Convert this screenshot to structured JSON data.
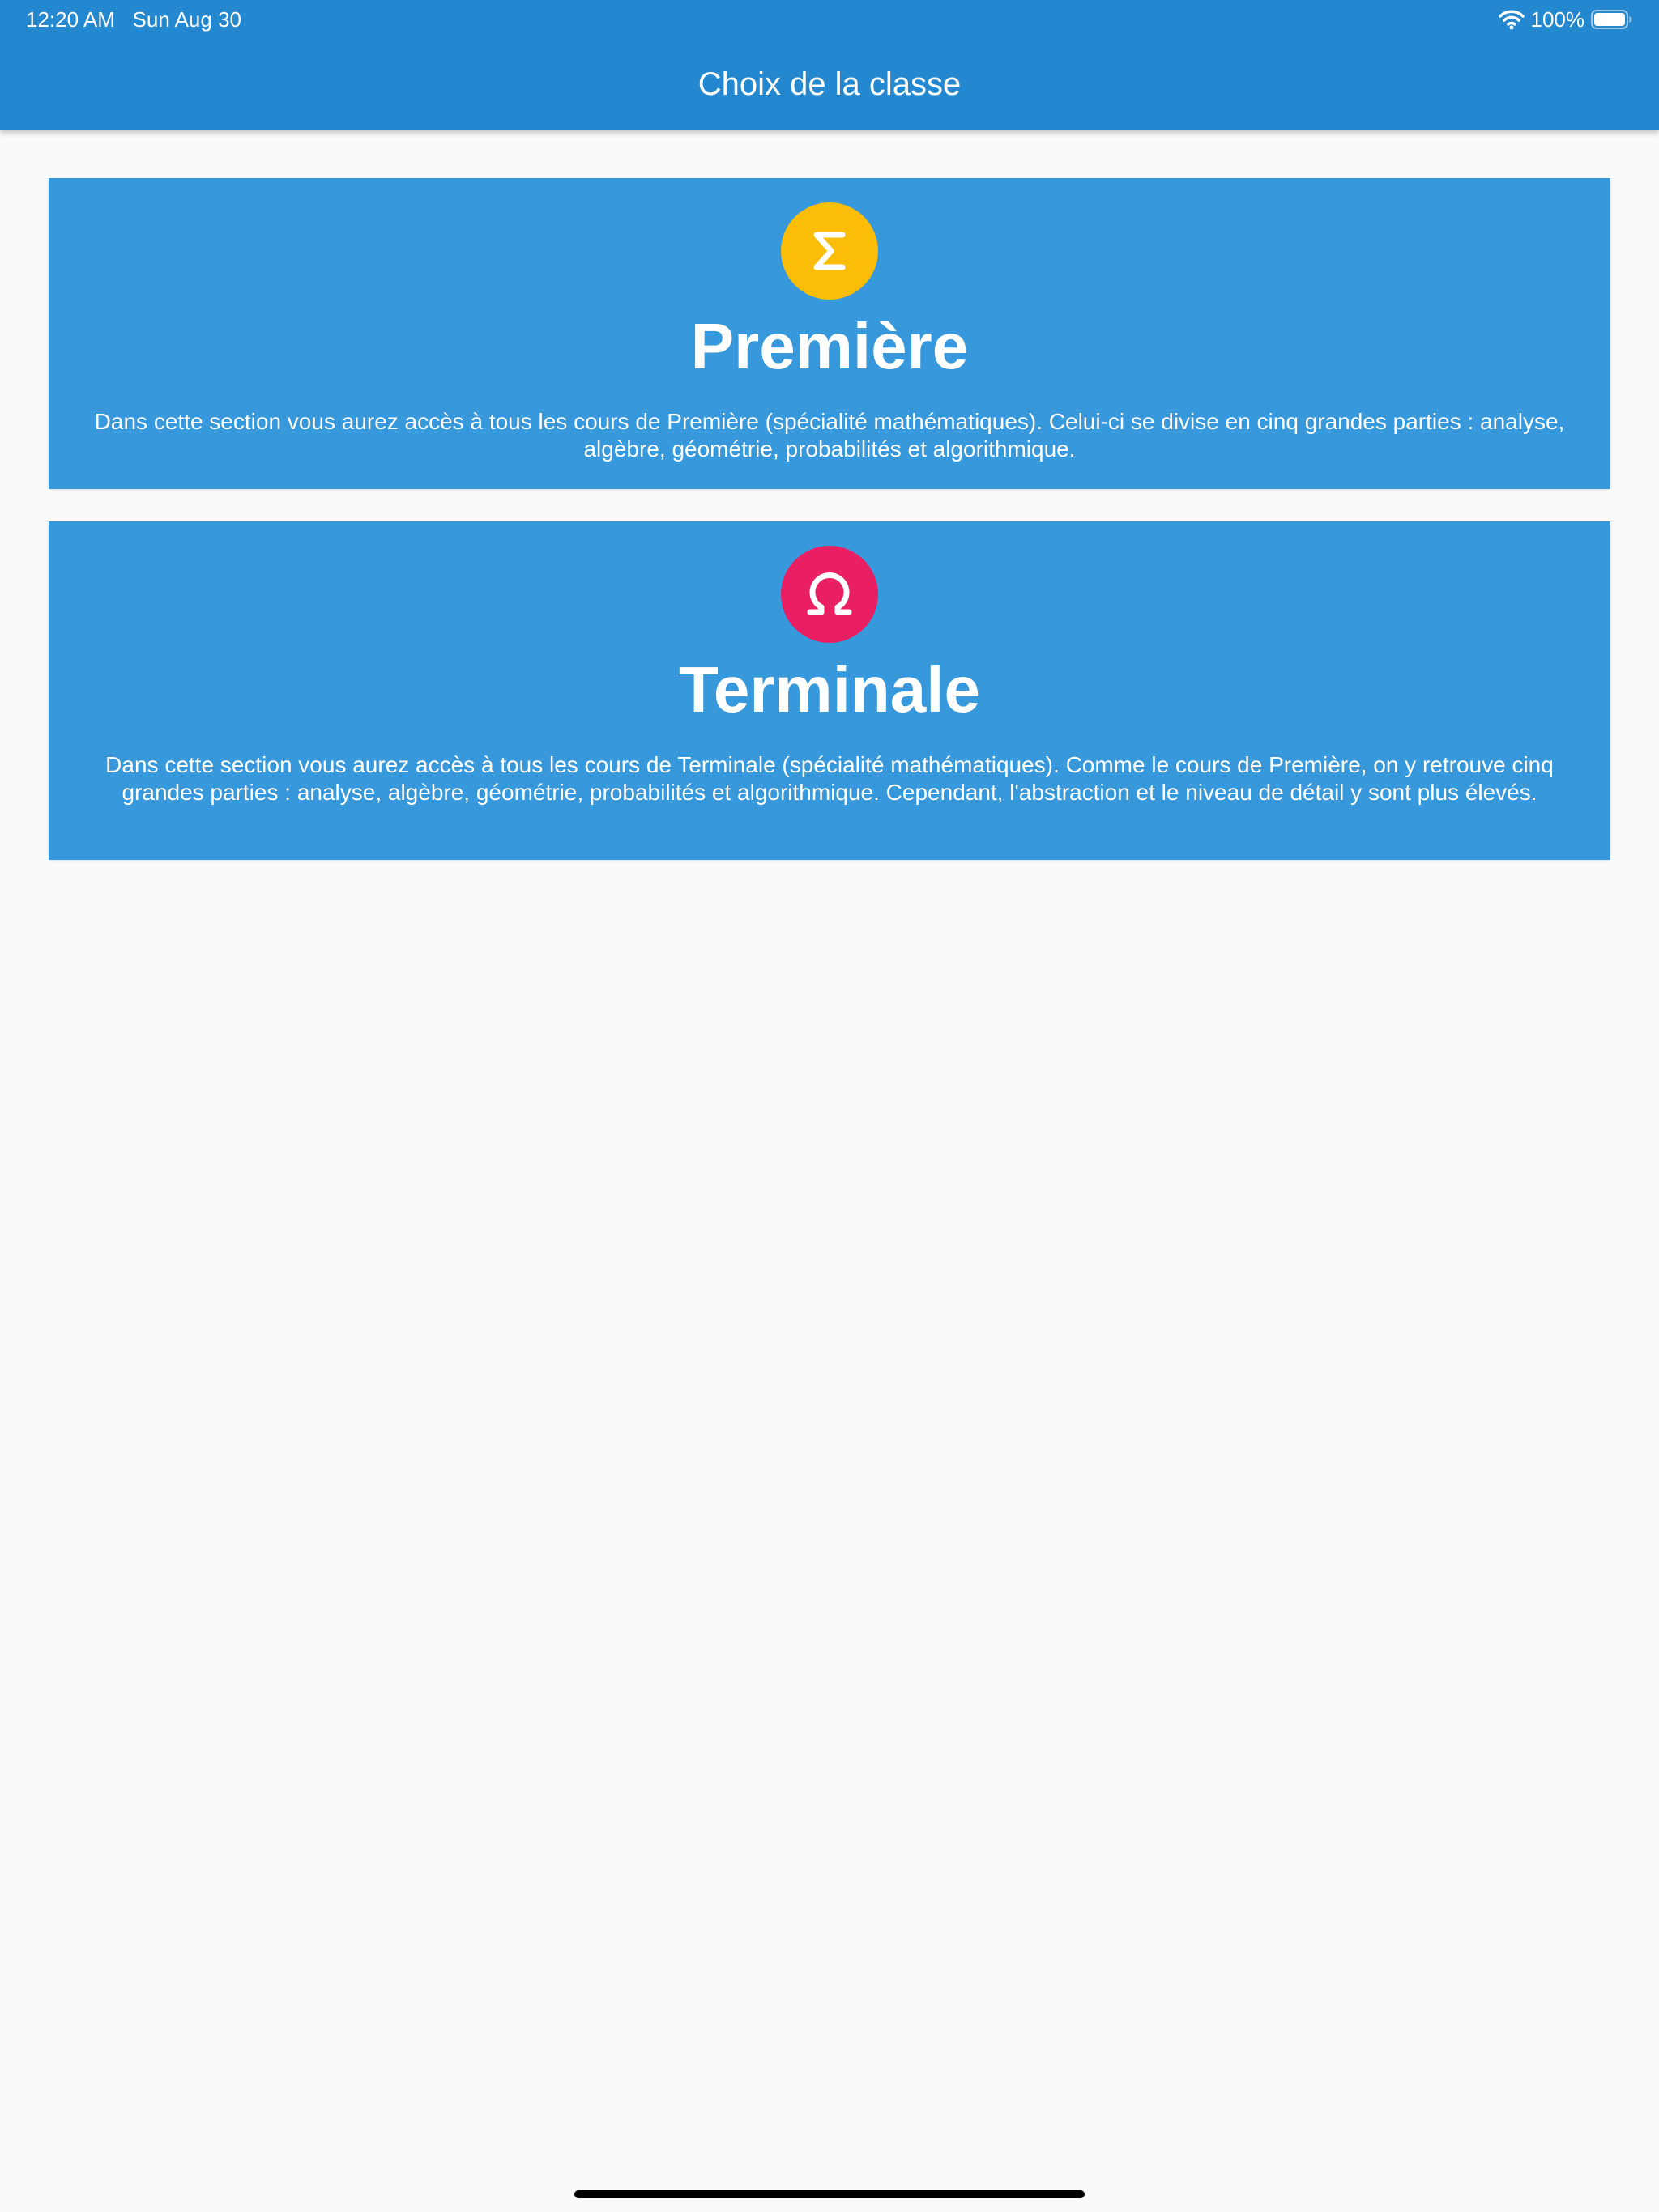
{
  "status_bar": {
    "time": "12:20 AM",
    "date": "Sun Aug 30",
    "battery": "100%",
    "wifi_icon": "wifi-icon",
    "battery_icon": "battery-full-icon"
  },
  "app_bar": {
    "title": "Choix de la classe",
    "color": "#2388cf"
  },
  "cards": [
    {
      "icon": "sigma-icon",
      "icon_glyph": "Σ",
      "icon_color": "#fbbd08",
      "title": "Première",
      "description": "Dans cette section vous aurez accès à tous les cours de Première (spécialité mathématiques). Celui-ci se divise en cinq grandes parties : analyse, algèbre, géométrie, probabilités et algorithmique.",
      "background": "#3799db"
    },
    {
      "icon": "omega-icon",
      "icon_glyph": "Ω",
      "icon_color": "#e91e63",
      "title": "Terminale",
      "description": "Dans cette section vous aurez accès à tous les cours de Terminale (spécialité mathématiques). Comme le cours de Première, on y retrouve cinq grandes parties : analyse, algèbre, géométrie, probabilités et algorithmique. Cependant, l'abstraction et le niveau de détail y sont plus élevés.",
      "background": "#3799db"
    }
  ]
}
